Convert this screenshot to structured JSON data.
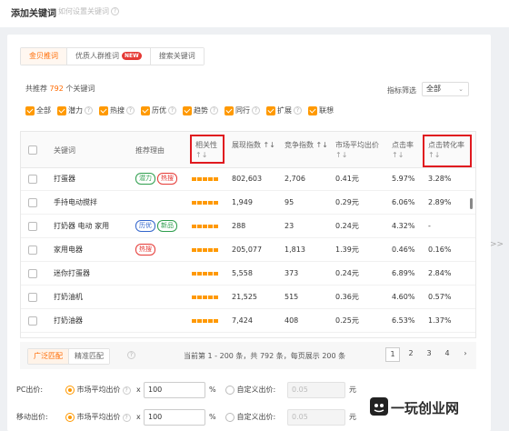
{
  "header": {
    "title": "添加关键词",
    "help": "如何设置关键词",
    "help_icon": "?"
  },
  "tabs": [
    {
      "label": "金贝推词",
      "active": true
    },
    {
      "label": "优质人群推词",
      "badge": "NEW"
    },
    {
      "label": "搜索关键词"
    }
  ],
  "summary": {
    "prefix": "共推荐",
    "count": "792",
    "suffix": "个关键词"
  },
  "filter": {
    "label": "指标筛选",
    "value": "全部"
  },
  "checks": [
    {
      "label": "全部",
      "checked": true,
      "help": false
    },
    {
      "label": "潜力",
      "checked": true,
      "help": true
    },
    {
      "label": "热搜",
      "checked": true,
      "help": true
    },
    {
      "label": "历优",
      "checked": true,
      "help": true
    },
    {
      "label": "趋势",
      "checked": true,
      "help": true
    },
    {
      "label": "同行",
      "checked": true,
      "help": true
    },
    {
      "label": "扩展",
      "checked": true,
      "help": true
    },
    {
      "label": "联想",
      "checked": true,
      "help": false
    }
  ],
  "columns": {
    "keyword": "关键词",
    "reason": "推荐理由",
    "relevance": "相关性",
    "impressions": "展现指数",
    "competition": "竞争指数",
    "avg_bid": "市场平均出价",
    "ctr": "点击率",
    "cvr": "点击转化率",
    "sort_glyph": "↑↓"
  },
  "rows": [
    {
      "keyword": "打蛋器",
      "tags": [
        {
          "text": "潜力",
          "color": "#2e9e4d"
        },
        {
          "text": "热搜",
          "color": "#e53935"
        }
      ],
      "impressions": "802,603",
      "competition": "2,706",
      "bid": "0.41元",
      "ctr": "5.97%",
      "cvr": "3.28%"
    },
    {
      "keyword": "手持电动搅拌",
      "tags": [],
      "impressions": "1,949",
      "competition": "95",
      "bid": "0.29元",
      "ctr": "6.06%",
      "cvr": "2.89%"
    },
    {
      "keyword": "打奶器 电动 家用",
      "tags": [
        {
          "text": "历优",
          "color": "#3366cc"
        },
        {
          "text": "新品",
          "color": "#2e9e4d"
        }
      ],
      "impressions": "288",
      "competition": "23",
      "bid": "0.24元",
      "ctr": "4.32%",
      "cvr": "-"
    },
    {
      "keyword": "家用电器",
      "tags": [
        {
          "text": "热搜",
          "color": "#e53935"
        }
      ],
      "impressions": "205,077",
      "competition": "1,813",
      "bid": "1.39元",
      "ctr": "0.46%",
      "cvr": "0.16%"
    },
    {
      "keyword": "迷你打蛋器",
      "tags": [],
      "impressions": "5,558",
      "competition": "373",
      "bid": "0.24元",
      "ctr": "6.89%",
      "cvr": "2.84%"
    },
    {
      "keyword": "打奶油机",
      "tags": [],
      "impressions": "21,525",
      "competition": "515",
      "bid": "0.36元",
      "ctr": "4.60%",
      "cvr": "0.57%"
    },
    {
      "keyword": "打奶油器",
      "tags": [],
      "impressions": "7,424",
      "competition": "408",
      "bid": "0.25元",
      "ctr": "6.53%",
      "cvr": "1.37%"
    }
  ],
  "match": {
    "broad": "广泛匹配",
    "exact": "精准匹配"
  },
  "pagination": {
    "info": "当前第 1 - 200 条，共 792 条，每页展示 200 条",
    "pages": [
      "1",
      "2",
      "3",
      "4"
    ],
    "active": "1",
    "next": "›"
  },
  "bids": [
    {
      "label": "PC出价:",
      "market": "市场平均出价",
      "x": "x",
      "value": "100",
      "pct": "%",
      "custom": "自定义出价:",
      "custom_value": "0.05",
      "unit": "元"
    },
    {
      "label": "移动出价:",
      "market": "市场平均出价",
      "x": "x",
      "value": "100",
      "pct": "%",
      "custom": "自定义出价:",
      "custom_value": "0.05",
      "unit": "元"
    }
  ],
  "side_arrow": ">>",
  "watermark": "一玩创业网",
  "accent": "#ff9900",
  "highlight": "#e0191f"
}
